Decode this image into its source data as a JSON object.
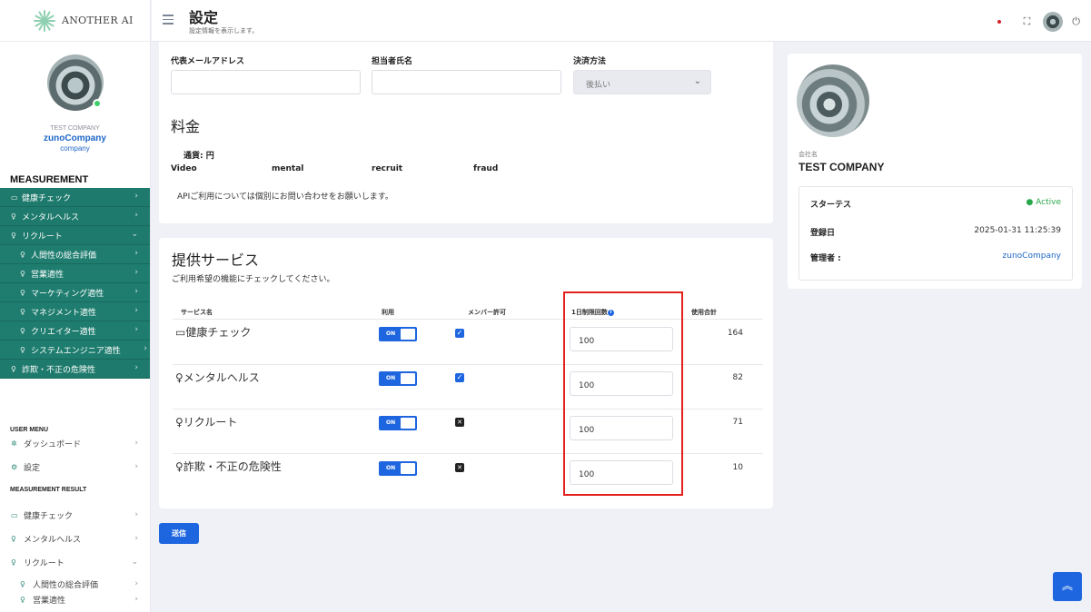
{
  "brand": {
    "logo_text": "ANOTHER AI"
  },
  "profile": {
    "company_label": "TEST COMPANY",
    "name": "zunoCompany",
    "role": "company"
  },
  "header": {
    "title": "設定",
    "subtitle": "設定情報を表示します。"
  },
  "sidebar": {
    "section_title": "MEASUREMENT",
    "measurement_items": [
      {
        "label": "健康チェック",
        "icon": "monitor-icon"
      },
      {
        "label": "メンタルヘルス",
        "icon": "mic-icon"
      },
      {
        "label": "リクルート",
        "icon": "mic-icon",
        "expanded": true
      },
      {
        "label": "人間性の総合評価",
        "icon": "mic-icon"
      },
      {
        "label": "営業適性",
        "icon": "mic-icon"
      },
      {
        "label": "マーケティング適性",
        "icon": "mic-icon"
      },
      {
        "label": "マネジメント適性",
        "icon": "mic-icon"
      },
      {
        "label": "クリエイター適性",
        "icon": "mic-icon"
      },
      {
        "label": "システムエンジニア適性",
        "icon": "mic-icon"
      },
      {
        "label": "詐欺・不正の危険性",
        "icon": "mic-icon"
      }
    ],
    "user_menu_title": "USER MENU",
    "user_menu": [
      {
        "label": "ダッシュボード",
        "icon": "dashboard-icon"
      },
      {
        "label": "設定",
        "icon": "gear-icon"
      }
    ],
    "result_title": "MEASUREMENT RESULT",
    "result_items": [
      {
        "label": "健康チェック",
        "icon": "monitor-icon"
      },
      {
        "label": "メンタルヘルス",
        "icon": "mic-icon"
      },
      {
        "label": "リクルート",
        "icon": "mic-icon"
      },
      {
        "label": "人間性の総合評価",
        "icon": "mic-icon"
      },
      {
        "label": "営業適性",
        "icon": "mic-icon"
      }
    ]
  },
  "form": {
    "email_label": "代表メールアドレス",
    "email_value": "",
    "contact_label": "担当者氏名",
    "contact_value": "",
    "payment_label": "決済方法",
    "payment_value": "後払い",
    "pricing_title": "料金",
    "currency": "通貨: 円",
    "price_columns": [
      "Video",
      "mental",
      "recruit",
      "fraud"
    ],
    "api_note": "APIご利用については個別にお問い合わせをお願いします。"
  },
  "services": {
    "title": "提供サービス",
    "subtitle": "ご利用希望の機能にチェックしてください。",
    "columns": {
      "name": "サービス名",
      "use": "利用",
      "member": "メンバー許可",
      "daily_limit": "1日制限回数",
      "total": "使用合計"
    },
    "rows": [
      {
        "name": "健康チェック",
        "icon": "monitor-icon",
        "use": "ON",
        "member": "checked",
        "limit": "100",
        "total": "164"
      },
      {
        "name": "メンタルヘルス",
        "icon": "mic-icon",
        "use": "ON",
        "member": "checked",
        "limit": "100",
        "total": "82"
      },
      {
        "name": "リクルート",
        "icon": "mic-icon",
        "use": "ON",
        "member": "x",
        "limit": "100",
        "total": "71"
      },
      {
        "name": "詐欺・不正の危険性",
        "icon": "mic-icon",
        "use": "ON",
        "member": "x",
        "limit": "100",
        "total": "10"
      }
    ],
    "submit_label": "送信"
  },
  "company_card": {
    "label": "会社名",
    "name": "TEST COMPANY",
    "status_label": "スターテス",
    "status_value": "● Active",
    "registered_label": "登録日",
    "registered_value": "2025-01-31 11:25:39",
    "admin_label": "管理者 :",
    "admin_value": "zunoCompany"
  },
  "colors": {
    "sidebar_active": "#1e7a6c",
    "primary": "#1e66e0",
    "highlight": "#e3201b",
    "active_status": "#27a84a"
  }
}
